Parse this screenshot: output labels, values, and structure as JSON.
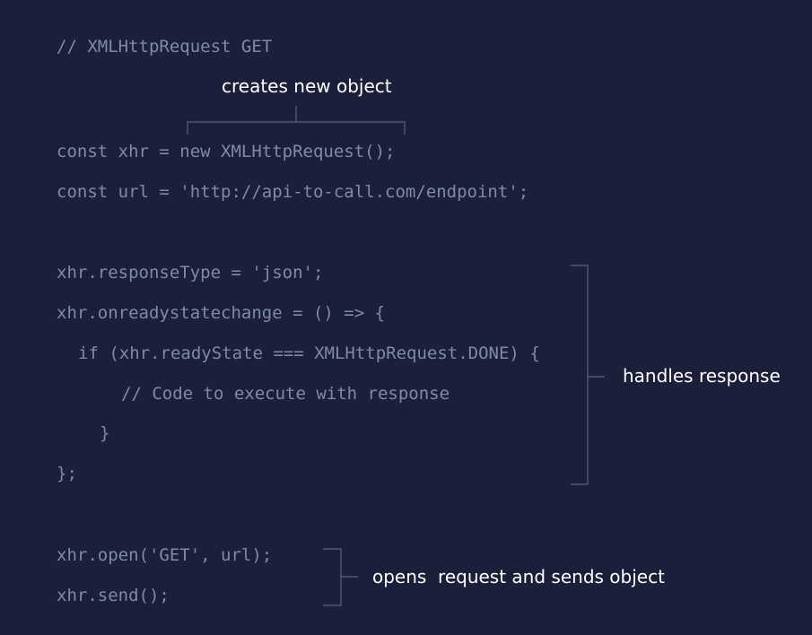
{
  "colors": {
    "background": "#1b1f3a",
    "code_text": "#7f8ba5",
    "annotation_text": "#ffffff",
    "bracket": "#56657e"
  },
  "code_lines": {
    "comment_title": "// XMLHttpRequest GET",
    "const_xhr": "const xhr = new XMLHttpRequest();",
    "const_url": "const url = 'http://api-to-call.com/endpoint';",
    "response_type": "xhr.responseType = 'json';",
    "onreadystatechange": "xhr.onreadystatechange = () => {",
    "if_ready": "if (xhr.readyState === XMLHttpRequest.DONE) {",
    "inner_comment": "// Code to execute with response",
    "close_if": "}",
    "close_handler": "};",
    "open": "xhr.open('GET', url);",
    "send": "xhr.send();"
  },
  "annotations": {
    "creates": "creates new object",
    "handles": "handles response",
    "opens": "opens  request and sends object"
  }
}
